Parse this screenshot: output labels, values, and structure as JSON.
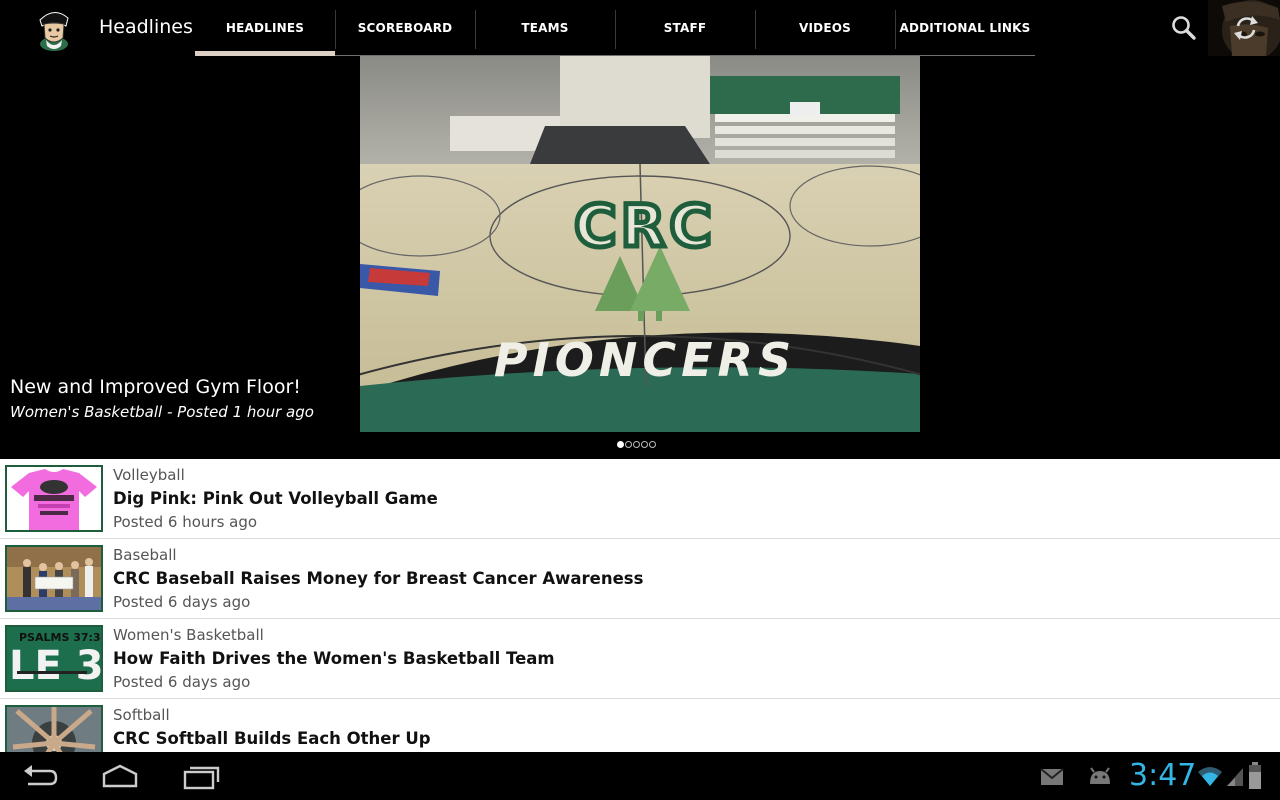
{
  "app": {
    "title": "Headlines"
  },
  "tabs": [
    {
      "label": "HEADLINES",
      "active": true
    },
    {
      "label": "SCOREBOARD",
      "active": false
    },
    {
      "label": "TEAMS",
      "active": false
    },
    {
      "label": "STAFF",
      "active": false
    },
    {
      "label": "VIDEOS",
      "active": false
    },
    {
      "label": "ADDITIONAL LINKS",
      "active": false
    }
  ],
  "actions": {
    "search_icon": "search-icon",
    "refresh_icon": "refresh-icon"
  },
  "featured": {
    "title": "New and Improved Gym Floor!",
    "subtitle": "Women's Basketball - Posted 1 hour ago",
    "image_text_center": "CRC",
    "image_text_bottom": "PIONCERS",
    "pager_total": 5,
    "pager_active": 1
  },
  "news": [
    {
      "category": "Volleyball",
      "title": "Dig Pink: Pink Out Volleyball Game",
      "posted": "Posted 6 hours ago"
    },
    {
      "category": "Baseball",
      "title": "CRC Baseball Raises Money for Breast Cancer Awareness",
      "posted": "Posted 6 days ago"
    },
    {
      "category": "Women's Basketball",
      "title": "How Faith Drives the Women's Basketball Team",
      "posted": "Posted 6 days ago",
      "thumb_text_top": "PSALMS 37:3",
      "thumb_text_big": "LE 3:"
    },
    {
      "category": "Softball",
      "title": "CRC Softball Builds Each Other Up",
      "posted": ""
    }
  ],
  "system": {
    "clock": "3:47",
    "accent": "#33b5e5"
  },
  "colors": {
    "tab_indicator": "#ddd0c4",
    "thumb_border": "#1e5e3c",
    "volleyball_pink": "#f26ce0"
  }
}
